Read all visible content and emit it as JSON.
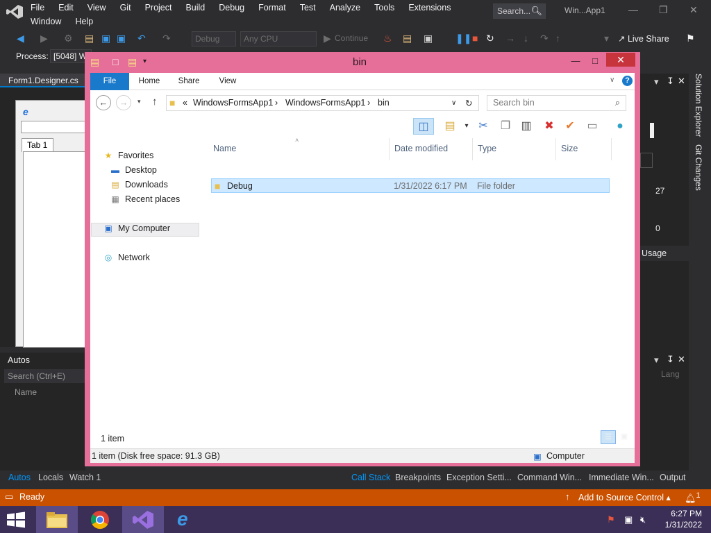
{
  "vs": {
    "menu": [
      "File",
      "Edit",
      "View",
      "Git",
      "Project",
      "Build",
      "Debug",
      "Format",
      "Test",
      "Analyze",
      "Tools",
      "Extensions",
      "Window",
      "Help"
    ],
    "search_placeholder": "Search...",
    "solution_name": "Win...App1",
    "toolbar": {
      "config": "Debug",
      "platform": "Any CPU",
      "continue": "Continue",
      "live_share": "Live Share"
    },
    "process_label": "Process:",
    "process_value": "[5048] W",
    "doc_tab": "Form1.Designer.cs",
    "designer_tab": "Tab 1",
    "autos_title": "Autos",
    "autos_search": "Search (Ctrl+E)",
    "autos_col_name": "Name",
    "right_labels": {
      "val_27": "27",
      "val_0": "0",
      "usage": "Usage",
      "lang": "Lang"
    },
    "vtabs": [
      "Solution Explorer",
      "Git Changes"
    ],
    "bottom_left_tabs": [
      "Autos",
      "Locals",
      "Watch 1"
    ],
    "bottom_right_tabs": [
      "Call Stack",
      "Breakpoints",
      "Exception Setti...",
      "Command Win...",
      "Immediate Win...",
      "Output"
    ],
    "status_ready": "Ready",
    "status_source": "Add to Source Control",
    "notification_count": "1"
  },
  "explorer": {
    "title": "bin",
    "ribbon_tabs": [
      "File",
      "Home",
      "Share",
      "View"
    ],
    "address_prefix": "«",
    "breadcrumb": [
      "WindowsFormsApp1",
      "WindowsFormsApp1",
      "bin"
    ],
    "search_placeholder": "Search bin",
    "nav": {
      "favorites": "Favorites",
      "favorites_items": [
        "Desktop",
        "Downloads",
        "Recent places"
      ],
      "computer": "My Computer",
      "network": "Network"
    },
    "columns": [
      "Name",
      "Date modified",
      "Type",
      "Size"
    ],
    "files": [
      {
        "name": "Debug",
        "date": "1/31/2022 6:17 PM",
        "type": "File folder",
        "size": ""
      }
    ],
    "item_count": "1 item",
    "status_left": "1 item (Disk free space: 91.3 GB)",
    "status_right": "Computer"
  },
  "taskbar": {
    "time": "6:27 PM",
    "date": "1/31/2022",
    "apps": [
      "file-explorer",
      "chrome",
      "visual-studio",
      "internet-explorer"
    ]
  },
  "colors": {
    "vs_bg": "#2d2d30",
    "vs_status": "#ca5100",
    "explorer_frame": "#e56f98",
    "ribbon_file": "#1979ca",
    "taskbar": "#3b2f57",
    "selection": "#cde8ff"
  }
}
